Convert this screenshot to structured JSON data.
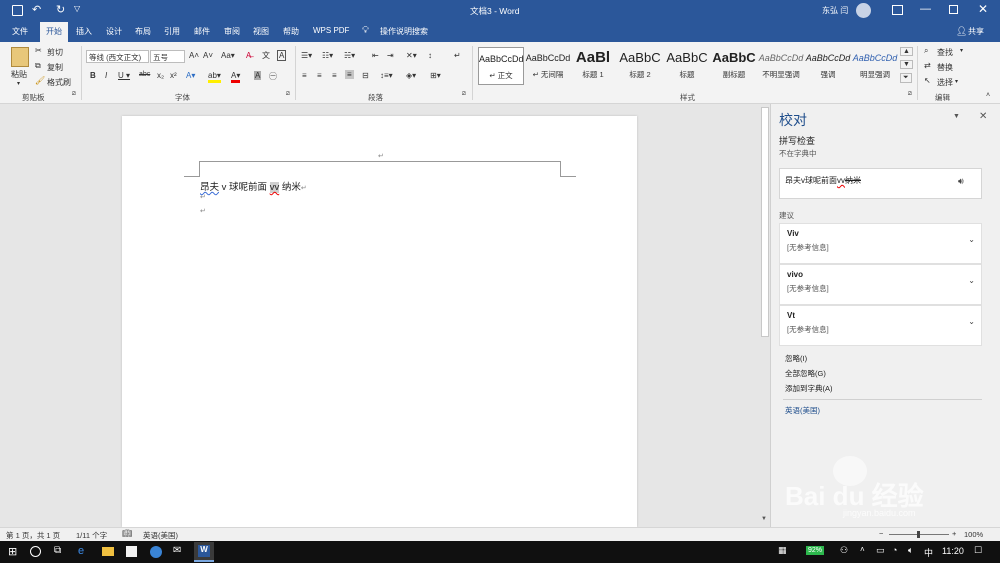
{
  "window": {
    "title": "文档3 - Word",
    "user": "东弘 闫",
    "share": "共享",
    "search_prompt": "操作说明搜索"
  },
  "tabs": [
    "文件",
    "开始",
    "插入",
    "设计",
    "布局",
    "引用",
    "邮件",
    "审阅",
    "视图",
    "帮助",
    "WPS PDF"
  ],
  "ribbon": {
    "clipboard": {
      "paste": "粘贴",
      "cut": "剪切",
      "copy": "复制",
      "format_painter": "格式刷",
      "label": "剪贴板"
    },
    "font": {
      "name": "等线 (西文正文)",
      "size": "五号",
      "label": "字体"
    },
    "paragraph": {
      "label": "段落"
    },
    "styles": {
      "items": [
        {
          "preview": "AaBbCcDd",
          "label": "↵ 正文"
        },
        {
          "preview": "AaBbCcDd",
          "label": "↵ 无间隔"
        },
        {
          "preview": "AaBl",
          "label": "标题 1"
        },
        {
          "preview": "AaBbC",
          "label": "标题 2"
        },
        {
          "preview": "AaBbC",
          "label": "标题"
        },
        {
          "preview": "AaBbC",
          "label": "副标题"
        },
        {
          "preview": "AaBbCcDd",
          "label": "不明显强调"
        },
        {
          "preview": "AaBbCcDd",
          "label": "强调"
        },
        {
          "preview": "AaBbCcDd",
          "label": "明显强调"
        }
      ],
      "label": "样式"
    },
    "editing": {
      "find": "查找",
      "replace": "替换",
      "select": "选择",
      "label": "编辑"
    }
  },
  "document": {
    "line_seg1": "昂夫",
    "line_seg2": " v 球呢前面 ",
    "line_misspelled": "vv",
    "line_seg3": " 纳米"
  },
  "pane": {
    "title": "校对",
    "section": "拼写检查",
    "subtitle": "不在字典中",
    "context_pre": "昂夫v球呢前面",
    "context_err": "vv",
    "context_post": "纳米",
    "suggestions_label": "建议",
    "suggestions": [
      {
        "word": "Viv",
        "desc": "[无参考信息]"
      },
      {
        "word": "vivo",
        "desc": "[无参考信息]"
      },
      {
        "word": "Vt",
        "desc": "[无参考信息]"
      }
    ],
    "ignore": "忽略(I)",
    "ignore_all": "全部忽略(G)",
    "add_dict": "添加到字典(A)",
    "language": "英语(美国)"
  },
  "status": {
    "page": "第 1 页，共 1 页",
    "words": "1/11 个字",
    "language": "英语(美国)",
    "zoom": "100%"
  },
  "taskbar": {
    "battery": "92%",
    "ime": "中",
    "time": "11:20"
  },
  "watermark": {
    "brand": "Bai du 经验",
    "url": "jingyan.baidu.com"
  }
}
